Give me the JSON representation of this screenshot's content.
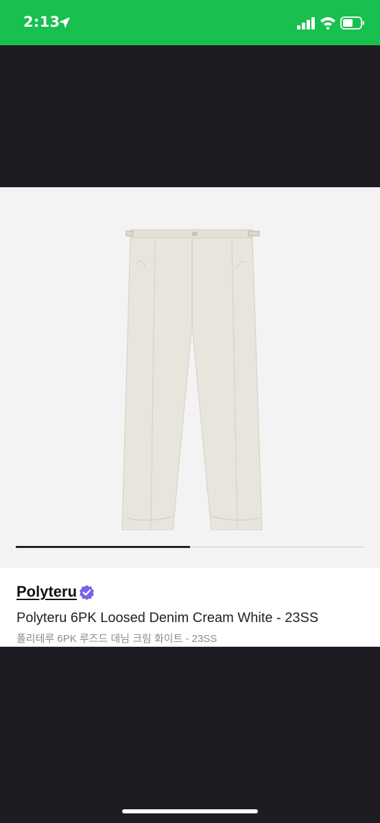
{
  "status_bar": {
    "time": "2:13",
    "background": "#17c04f"
  },
  "icons": {
    "location": "location-arrow-icon",
    "signal": "cellular-signal-icon",
    "wifi": "wifi-icon",
    "battery": "battery-icon",
    "verified": "verified-badge-icon"
  },
  "gallery": {
    "image": "cream-white-trousers-photo",
    "progress": 0.5
  },
  "product": {
    "brand": "Polyteru",
    "title": "Polyteru 6PK Loosed Denim Cream White - 23SS",
    "subtitle": "폴리테루 6PK 루즈드 데님 크림 화이트 - 23SS"
  },
  "colors": {
    "accent_verified": "#7b61e8",
    "dark_background": "#1c1c22"
  }
}
